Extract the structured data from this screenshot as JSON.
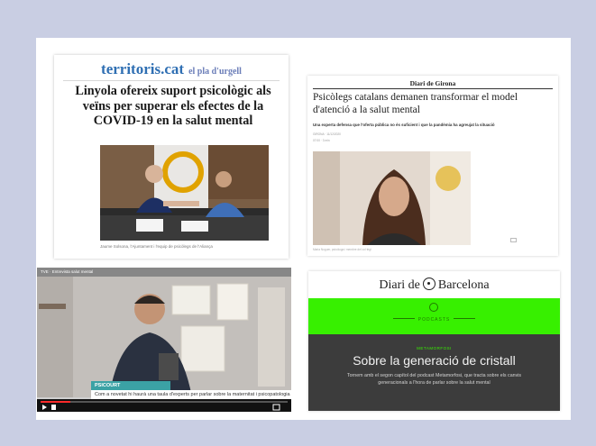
{
  "card_territoris": {
    "brand": "territoris.cat",
    "edition": "el pla d'urgell",
    "headline": "Linyola ofereix suport psicològic als veïns per superar els efectes de la COVID-19 en la salut mental",
    "caption": "Jaume Solsona, l'Ajuntament i l'equip de psicòlegs de l'Aliança"
  },
  "card_girona": {
    "masthead": "Diari de Girona",
    "headline": "Psicòlegs catalans demanen transformar el model d'atenció a la salut mental",
    "standfirst": "Una experta defensa que l'oferta pública no és suficient i que la pandèmia ha agreujat la situació",
    "meta": "GIRONA · 11/12/2020",
    "meta2": "07:00 · 3 min",
    "caption": "Maria Noguer, psicòloga i membre del col·legi"
  },
  "card_video": {
    "video_title": "TVE · Entrevista salut mental",
    "badge": "PSICOURT",
    "lower_third": "Com a novetat hi haurà una taula d'experts per parlar sobre la maternitat i psicopatologia",
    "progress": 0.12
  },
  "card_barcelona": {
    "masthead_left": "Diari de",
    "masthead_right": "Barcelona",
    "section": "PODCASTS",
    "kicker": "METAMORFOSI",
    "title": "Sobre la generació de cristall",
    "description": "Tornem amb el segon capítol del podcast Metamorfosi, que tracta sobre els canvis generacionals a l'hora de parlar sobre la salut mental"
  },
  "colors": {
    "background": "#c9cee3",
    "territoris_blue": "#2f6fb3",
    "podcast_green": "#37f000",
    "dark_panel": "#3c3c3c",
    "badge_teal": "#3ba2a5"
  }
}
